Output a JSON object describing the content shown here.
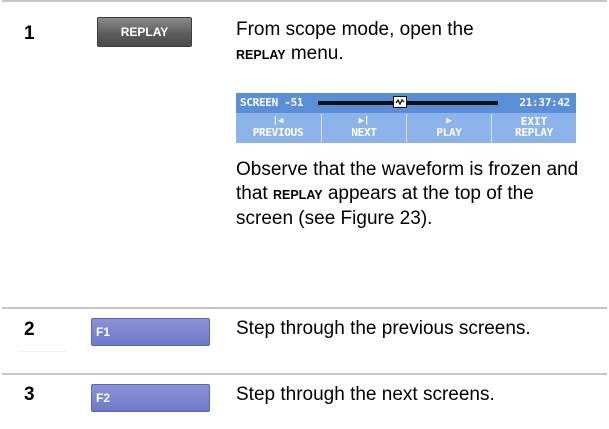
{
  "steps": [
    {
      "number": "1",
      "key_label": "REPLAY",
      "text_before": "From scope mode, open the",
      "text_keyword": "REPLAY",
      "text_after": " menu.",
      "note_part1": "Observe that the waveform is frozen and that ",
      "note_keyword": "REPLAY",
      "note_part2": " appears at the top of the screen (see Figure 23)."
    },
    {
      "number": "2",
      "key_label": "F1",
      "text": "Step through the previous screens."
    },
    {
      "number": "3",
      "key_label": "F2",
      "text": "Step through the next screens."
    }
  ],
  "replay_menu": {
    "title": "SCREEN -51",
    "time": "21:37:42",
    "softkeys": [
      {
        "icon": "previous-icon",
        "glyph": "|◀",
        "line1": "",
        "line2": "PREVIOUS"
      },
      {
        "icon": "next-icon",
        "glyph": "▶|",
        "line1": "",
        "line2": "NEXT"
      },
      {
        "icon": "play-icon",
        "glyph": "▶",
        "line1": "",
        "line2": "PLAY"
      },
      {
        "icon": "exit-icon",
        "glyph": "",
        "line1": "EXIT",
        "line2": "REPLAY"
      }
    ]
  },
  "colors": {
    "menu_top": "#5b8ed8",
    "menu_bottom": "#8db4ea",
    "function_key": "#7780cc",
    "replay_key": "#5e5e5e",
    "separator": "#c7c7c7"
  }
}
